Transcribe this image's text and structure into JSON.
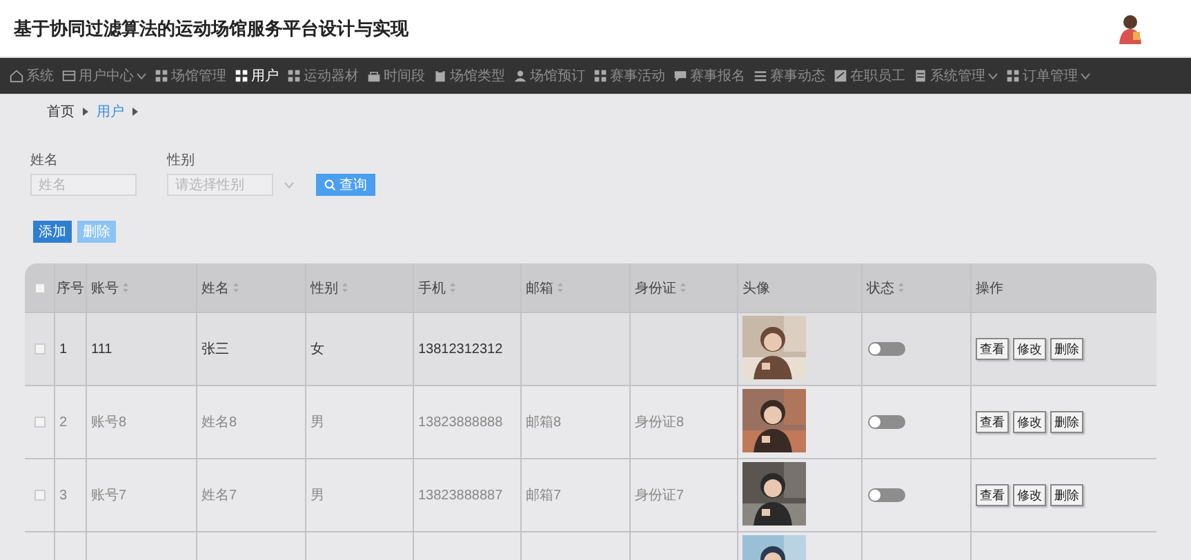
{
  "window": {
    "title": "基于协同过滤算法的运动场馆服务平台设计与实现"
  },
  "nav": [
    {
      "label": "系统",
      "selected": false,
      "dropdown": false
    },
    {
      "label": "用户中心",
      "selected": false,
      "dropdown": true
    },
    {
      "label": "场馆管理",
      "selected": false,
      "dropdown": false
    },
    {
      "label": "用户",
      "selected": true,
      "dropdown": false
    },
    {
      "label": "运动器材",
      "selected": false,
      "dropdown": false
    },
    {
      "label": "时间段",
      "selected": false,
      "dropdown": false
    },
    {
      "label": "场馆类型",
      "selected": false,
      "dropdown": false
    },
    {
      "label": "场馆预订",
      "selected": false,
      "dropdown": false
    },
    {
      "label": "赛事活动",
      "selected": false,
      "dropdown": false
    },
    {
      "label": "赛事报名",
      "selected": false,
      "dropdown": false
    },
    {
      "label": "赛事动态",
      "selected": false,
      "dropdown": false
    },
    {
      "label": "在职员工",
      "selected": false,
      "dropdown": false
    },
    {
      "label": "系统管理",
      "selected": false,
      "dropdown": true
    },
    {
      "label": "订单管理",
      "selected": false,
      "dropdown": true
    }
  ],
  "breadcrumb": [
    {
      "label": "首页",
      "selected": false
    },
    {
      "label": "用户",
      "selected": true
    }
  ],
  "filters": [
    {
      "label": "姓名",
      "placeholder": "姓名",
      "kind": "text"
    },
    {
      "label": "性别",
      "placeholder": "请选择性别",
      "kind": "select"
    }
  ],
  "search_button": "查询",
  "actions": [
    {
      "label": "添加",
      "kind": "primary"
    },
    {
      "label": "删除",
      "kind": "light"
    }
  ],
  "table": {
    "select_all_checked": false,
    "columns": [
      {
        "label": "序号",
        "sortable": false
      },
      {
        "label": "账号",
        "sortable": true
      },
      {
        "label": "姓名",
        "sortable": true
      },
      {
        "label": "性别",
        "sortable": true
      },
      {
        "label": "手机",
        "sortable": true
      },
      {
        "label": "邮箱",
        "sortable": true
      },
      {
        "label": "身份证",
        "sortable": true
      },
      {
        "label": "头像",
        "sortable": false
      },
      {
        "label": "状态",
        "sortable": true
      },
      {
        "label": "操作",
        "sortable": false
      }
    ],
    "rows": [
      {
        "checked": false,
        "highlighted": true,
        "cells": [
          "1",
          "111",
          "张三",
          "女",
          "13812312312",
          "",
          ""
        ],
        "avatar": {
          "kind": "picture"
        },
        "status_on": false,
        "row_actions": [
          "查看",
          "修改",
          "删除"
        ]
      },
      {
        "checked": false,
        "highlighted": false,
        "cells": [
          "2",
          "账号8",
          "姓名8",
          "男",
          "13823888888",
          "邮箱8",
          "身份证8"
        ],
        "avatar": {
          "kind": "picture"
        },
        "status_on": false,
        "row_actions": [
          "查看",
          "修改",
          "删除"
        ]
      },
      {
        "checked": false,
        "highlighted": false,
        "cells": [
          "3",
          "账号7",
          "姓名7",
          "男",
          "13823888887",
          "邮箱7",
          "身份证7"
        ],
        "avatar": {
          "kind": "picture"
        },
        "status_on": false,
        "row_actions": [
          "查看",
          "修改",
          "删除"
        ]
      },
      {
        "avatar": {
          "kind": "picture"
        }
      }
    ]
  }
}
